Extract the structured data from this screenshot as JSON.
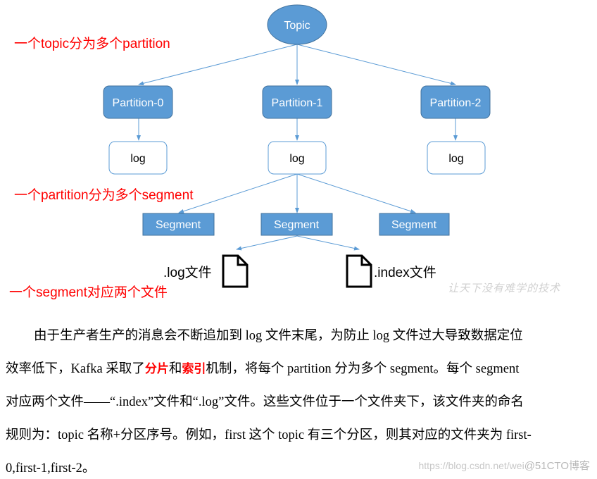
{
  "diagram": {
    "topic": "Topic",
    "partitions": [
      "Partition-0",
      "Partition-1",
      "Partition-2"
    ],
    "logs": [
      "log",
      "log",
      "log"
    ],
    "segments": [
      "Segment",
      "Segment",
      "Segment"
    ],
    "files": {
      "log_file": ".log文件",
      "index_file": ".index文件"
    },
    "annotations": {
      "topic_partition": "一个topic分为多个partition",
      "partition_segment": "一个partition分为多个segment",
      "segment_files": "一个segment对应两个文件"
    },
    "colors": {
      "node_fill": "#5b9bd5",
      "node_stroke": "#41719c",
      "log_stroke": "#5b9bd5",
      "arrow": "#5b9bd5",
      "annotation": "#ff0000"
    },
    "watermark": "让天下没有难学的技术"
  },
  "paragraph": {
    "line1": "由于生产者生产的消息会不断追加到 log 文件末尾，为防止 log 文件过大导致数据定位",
    "line2_pre": "效率低下，Kafka 采取了",
    "line2_hl1": "分片",
    "line2_mid": "和",
    "line2_hl2": "索引",
    "line2_post": "机制，将每个 partition 分为多个 segment。每个 segment",
    "line3": "对应两个文件——“.index”文件和“.log”文件。这些文件位于一个文件夹下，该文件夹的命名",
    "line4": "规则为：topic 名称+分区序号。例如，first 这个 topic 有三个分区，则其对应的文件夹为 first-",
    "line5": "0,first-1,first-2。"
  },
  "footer_watermark": {
    "url": "https://blog.csdn.net/wei",
    "site": "@51CTO博客"
  }
}
